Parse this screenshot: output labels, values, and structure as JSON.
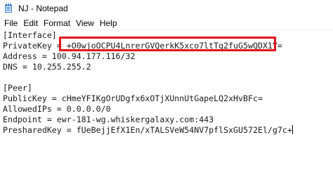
{
  "window": {
    "title": "NJ - Notepad",
    "icon": "notepad-icon"
  },
  "menu": [
    "File",
    "Edit",
    "Format",
    "View",
    "Help"
  ],
  "editor": {
    "lines": [
      "[Interface]",
      "PrivateKey = +O0wjoOCPU4LnrerGVQerkK5xco7ltTg2fuG5wQDX1Y=",
      "Address = 100.94.177.116/32",
      "DNS = 10.255.255.2",
      "",
      "[Peer]",
      "PublicKey = cHmeYFIKgOrUDgfx6xOTjXUnnUtGapeLQ2xHvBFc=",
      "AllowedIPs = 0.0.0.0/0",
      "Endpoint = ewr-181-wg.whiskergalaxy.com:443",
      "PresharedKey = fUeBejjEfX1En/xTALSVeW54NV7pflSxGU572El/g7c+"
    ]
  },
  "annotation": {
    "color": "#e0161b",
    "target": "PrivateKey value"
  }
}
